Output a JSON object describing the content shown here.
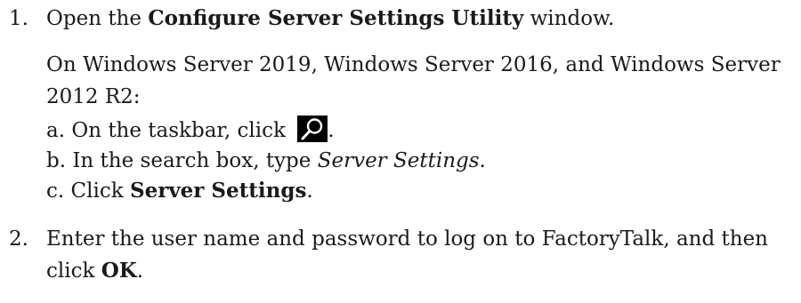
{
  "steps": [
    {
      "number": "1.",
      "intro_before": "Open the ",
      "intro_bold": "Configure Server Settings Utility",
      "intro_after": " window.",
      "os_note_line1": "On Windows Server 2019, Windows Server 2016, and Windows Server",
      "os_note_line2": "2012 R2:",
      "substep_a_before": "a. On the taskbar, click ",
      "substep_a_after": ".",
      "substep_b_before": "b. In the search box, type ",
      "substep_b_italic": "Server Settings",
      "substep_b_after": ".",
      "substep_c_before": "c. Click ",
      "substep_c_bold": "Server Settings",
      "substep_c_after": "."
    },
    {
      "number": "2.",
      "line1": "Enter the user name and password to log on to FactoryTalk, and then",
      "line2_before": "click ",
      "line2_bold": "OK",
      "line2_after": "."
    }
  ],
  "icons": {
    "search": "search-icon"
  }
}
